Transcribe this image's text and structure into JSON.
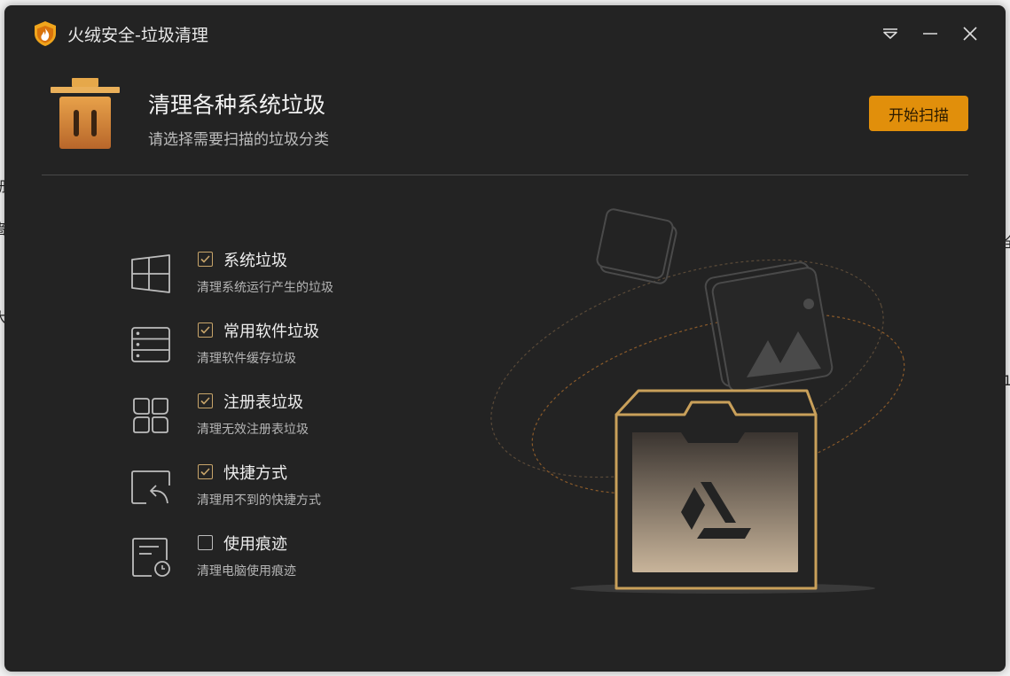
{
  "app": {
    "title": "火绒安全-垃圾清理"
  },
  "header": {
    "title": "清理各种系统垃圾",
    "subtitle": "请选择需要扫描的垃圾分类",
    "scan_button": "开始扫描"
  },
  "window_controls": [
    "menu-icon",
    "minimize-icon",
    "close-icon"
  ],
  "categories": [
    {
      "icon": "windows-icon",
      "label": "系统垃圾",
      "desc": "清理系统运行产生的垃圾",
      "checked": true
    },
    {
      "icon": "software-list-icon",
      "label": "常用软件垃圾",
      "desc": "清理软件缓存垃圾",
      "checked": true
    },
    {
      "icon": "registry-icon",
      "label": "注册表垃圾",
      "desc": "清理无效注册表垃圾",
      "checked": true
    },
    {
      "icon": "shortcut-icon",
      "label": "快捷方式",
      "desc": "清理用不到的快捷方式",
      "checked": true
    },
    {
      "icon": "usage-trace-icon",
      "label": "使用痕迹",
      "desc": "清理电脑使用痕迹",
      "checked": false
    }
  ],
  "colors": {
    "accent": "#e18f0b",
    "window_bg": "#232323",
    "check_color": "#c8a56a"
  }
}
